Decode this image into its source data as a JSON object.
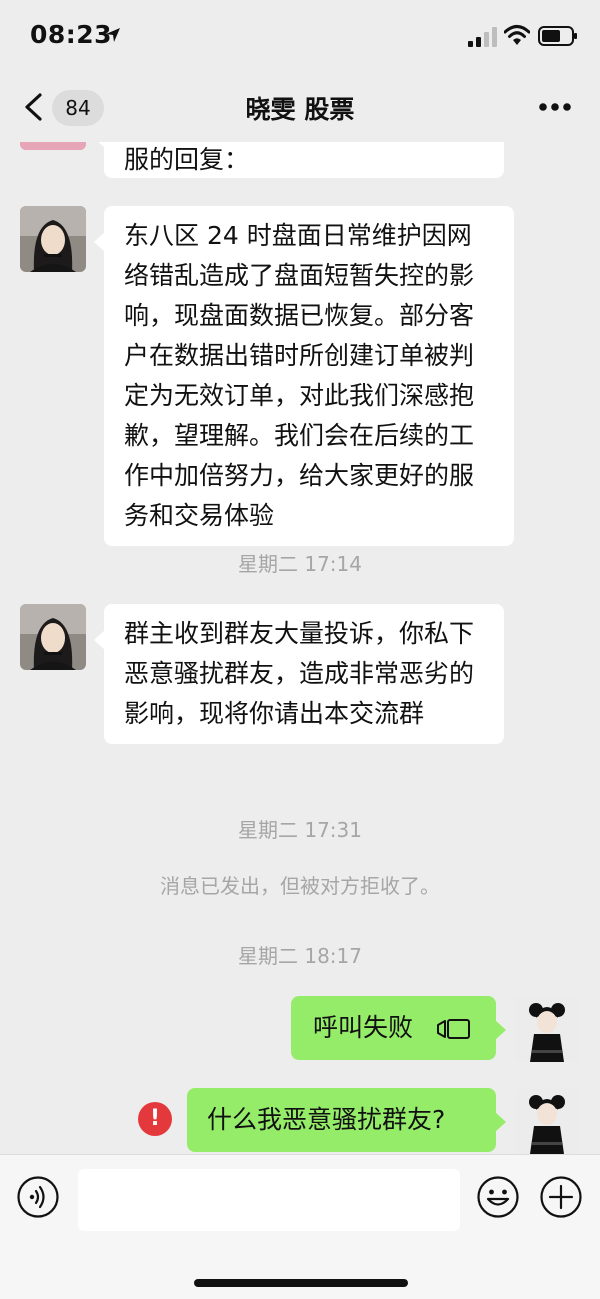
{
  "status_bar": {
    "time": "08:23",
    "icons": [
      "location-arrow-icon",
      "signal-icon",
      "wifi-icon",
      "battery-icon"
    ]
  },
  "nav": {
    "back_badge": "84",
    "title": "晓雯 股票",
    "icons": [
      "back-chevron-icon",
      "more-icon"
    ]
  },
  "messages": {
    "m0": {
      "text": "服的回复："
    },
    "m1": {
      "text": "东八区 24 时盘面日常维护因网络错乱造成了盘面短暂失控的影响，现盘面数据已恢复。部分客户在数据出错时所创建订单被判定为无效订单，对此我们深感抱歉，望理解。我们会在后续的工作中加倍努力，给大家更好的服务和交易体验"
    },
    "t1": "星期二 17:14",
    "m2": {
      "text": "群主收到群友大量投诉，你私下恶意骚扰群友，造成非常恶劣的影响，现将你请出本交流群"
    },
    "t2": "星期二 17:31",
    "notice": "消息已发出，但被对方拒收了。",
    "t3": "星期二 18:17",
    "m3": {
      "text": "呼叫失败",
      "icon": "video-call-icon"
    },
    "m4": {
      "text": "什么我恶意骚扰群友?",
      "status": "!"
    }
  },
  "input_bar": {
    "placeholder": "",
    "icons": [
      "voice-icon",
      "emoji-icon",
      "plus-icon"
    ]
  },
  "colors": {
    "background": "#ededed",
    "sent_bubble": "#95ec69",
    "received_bubble": "#ffffff",
    "error": "#e4393c"
  }
}
